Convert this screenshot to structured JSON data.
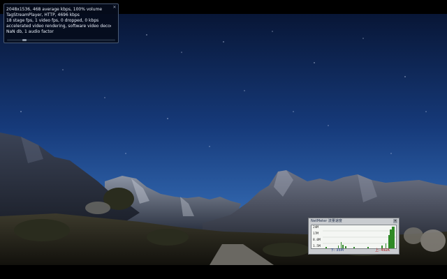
{
  "stats_overlay": {
    "lines": [
      "2048x1536, 468 average kbps, 100% volume",
      "TagStreamPlayer, HTTP, 4696 kbps",
      "18 stage fps, 1 video fps, 0 dropped, 0 kbps",
      "accelerated video rendering, software video decoding",
      "NaN db, 1 audio factor"
    ],
    "close_icon": "close-icon",
    "scroll_position": 0.15
  },
  "netmeter": {
    "title": "NetMeter 流量速度",
    "close_icon": "close-icon",
    "scale_labels": [
      "24M",
      "17M",
      "8.0M",
      "1.5M"
    ],
    "download_label": "下: 35M",
    "upload_label": "上: 492K",
    "colors": {
      "download": "#1f3b86",
      "upload": "#b01818",
      "graph": "#2f8a26"
    }
  },
  "scene": {
    "description_icon": "video-frame",
    "colors": {
      "sky_top": "#0a1a44",
      "sky_bottom": "#2d5ea6",
      "mountain": "#3a4150"
    }
  }
}
